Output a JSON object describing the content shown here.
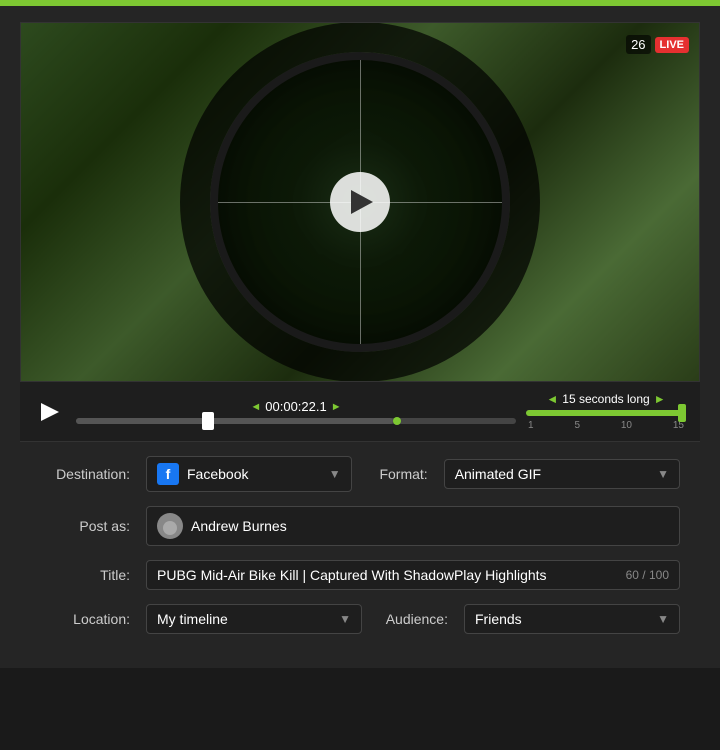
{
  "topbar": {
    "color": "#7dc832"
  },
  "video": {
    "live_number": "26",
    "live_label": "LIVE"
  },
  "player": {
    "play_label": "Play",
    "time_current": "00:00:22.1",
    "time_duration_label": "15 seconds long",
    "trim_ticks": [
      "1",
      "5",
      "10",
      "15"
    ]
  },
  "form": {
    "destination_label": "Destination:",
    "destination_value": "Facebook",
    "format_label": "Format:",
    "format_value": "Animated GIF",
    "postas_label": "Post as:",
    "postas_value": "Andrew Burnes",
    "title_label": "Title:",
    "title_value": "PUBG Mid-Air Bike Kill | Captured With ShadowPlay Highlights",
    "title_char_count": "60 / 100",
    "location_label": "Location:",
    "location_value": "My timeline",
    "audience_label": "Audience:",
    "audience_value": "Friends"
  }
}
